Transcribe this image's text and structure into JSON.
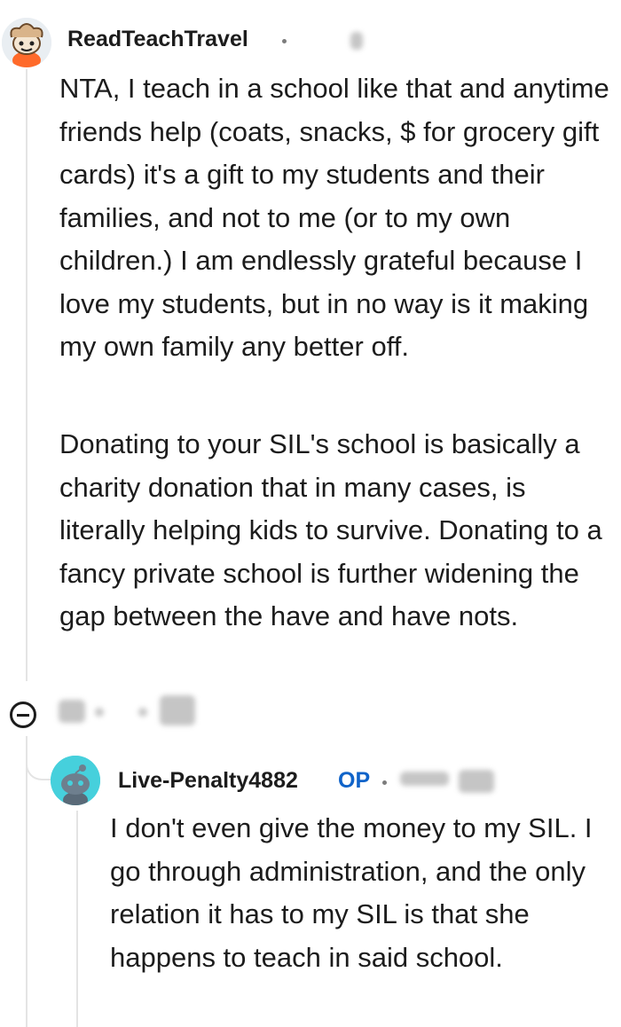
{
  "comment": {
    "username": "ReadTeachTravel",
    "paragraphs": [
      "NTA, I teach in a school like that and anytime friends help (coats, snacks, $ for grocery gift cards) it's a gift to my students and their families, and not to me (or to my own children.) I am endlessly grateful because I love my students, but in no way is it making my own family any better off.",
      "Donating to your SIL's school is basically a charity donation that in many cases, is literally helping kids to survive. Donating to a fancy private school is further widening the gap between the have and have nots."
    ],
    "avatar_icon": "reddit-snoo-avatar",
    "collapse_icon": "collapse-circle-minus-icon"
  },
  "reply": {
    "username": "Live-Penalty4882",
    "badge": "OP",
    "text": "I don't even give the money to my SIL. I go through administration, and the only relation it has to my SIL is that she happens to teach in said school.",
    "avatar_icon": "reddit-snoo-avatar",
    "avatar_color": "#46d0dc"
  },
  "colors": {
    "op_badge": "#0f63c9",
    "thread_line": "#e4e4e4",
    "text": "#1c1c1c"
  }
}
